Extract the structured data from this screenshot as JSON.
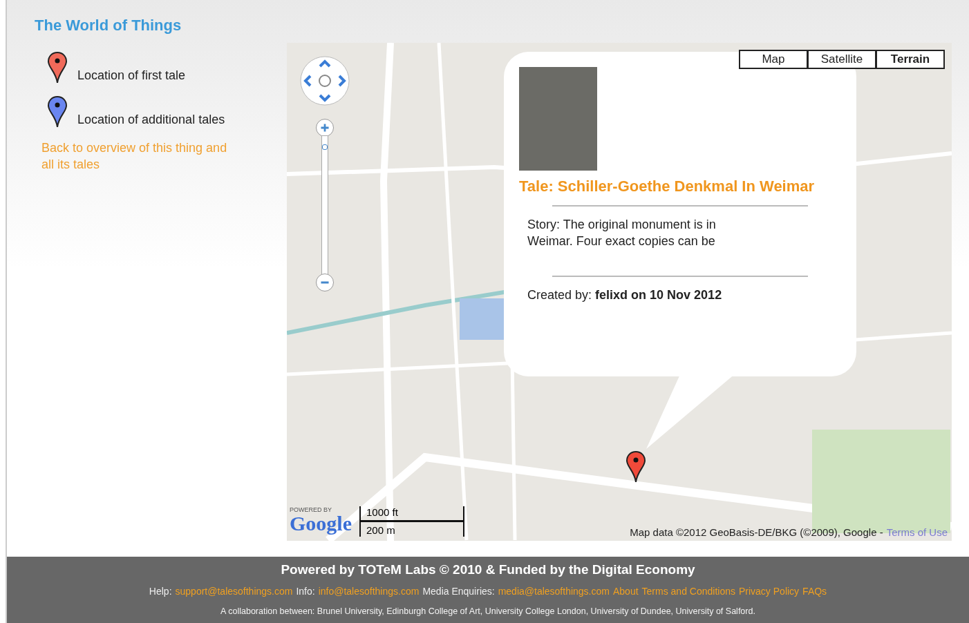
{
  "site_title": "The World of Things",
  "legend": [
    {
      "label": "Location of first tale",
      "color": "#f06a5a"
    },
    {
      "label": "Location of additional tales",
      "color": "#6a86f0"
    }
  ],
  "back_link": "Back to overview of this thing and all its tales",
  "map": {
    "map_types": [
      {
        "label": "Map",
        "selected": false
      },
      {
        "label": "Satellite",
        "selected": false
      },
      {
        "label": "Terrain",
        "selected": true
      }
    ],
    "zoom": {
      "level": 0.94
    },
    "info_window": {
      "title": "Tale: Schiller-Goethe Denkmal In Weimar",
      "story": "Story: The original monument is in Weimar. Four exact copies can be",
      "created": "Created by: **felixd on 10 Nov 2012**"
    },
    "logo_caption": "POWERED BY",
    "logo": "Google",
    "scale": [
      "1000 ft",
      "200 m"
    ],
    "attribution": "Map data ©2012 GeoBasis-DE/BKG (©2009), Google -",
    "terms_link": "Terms of Use"
  },
  "footer": {
    "headline": "Powered by TOTeM Labs © 2010 & Funded by the Digital Economy",
    "links": [
      {
        "kind": "label",
        "text": "Help:"
      },
      {
        "kind": "link",
        "text": "support@talesofthings.com"
      },
      {
        "kind": "label",
        "text": "Info:"
      },
      {
        "kind": "link",
        "text": "info@talesofthings.com"
      },
      {
        "kind": "label",
        "text": "Media Enquiries:"
      },
      {
        "kind": "link",
        "text": "media@talesofthings.com"
      },
      {
        "kind": "link",
        "text": "About"
      },
      {
        "kind": "link",
        "text": "Terms and Conditions"
      },
      {
        "kind": "link",
        "text": "Privacy Policy"
      },
      {
        "kind": "link",
        "text": "FAQs"
      }
    ],
    "collaboration": "A collaboration between: Brunel University, Edinburgh College of Art, University College London, University of Dundee, University of Salford."
  }
}
